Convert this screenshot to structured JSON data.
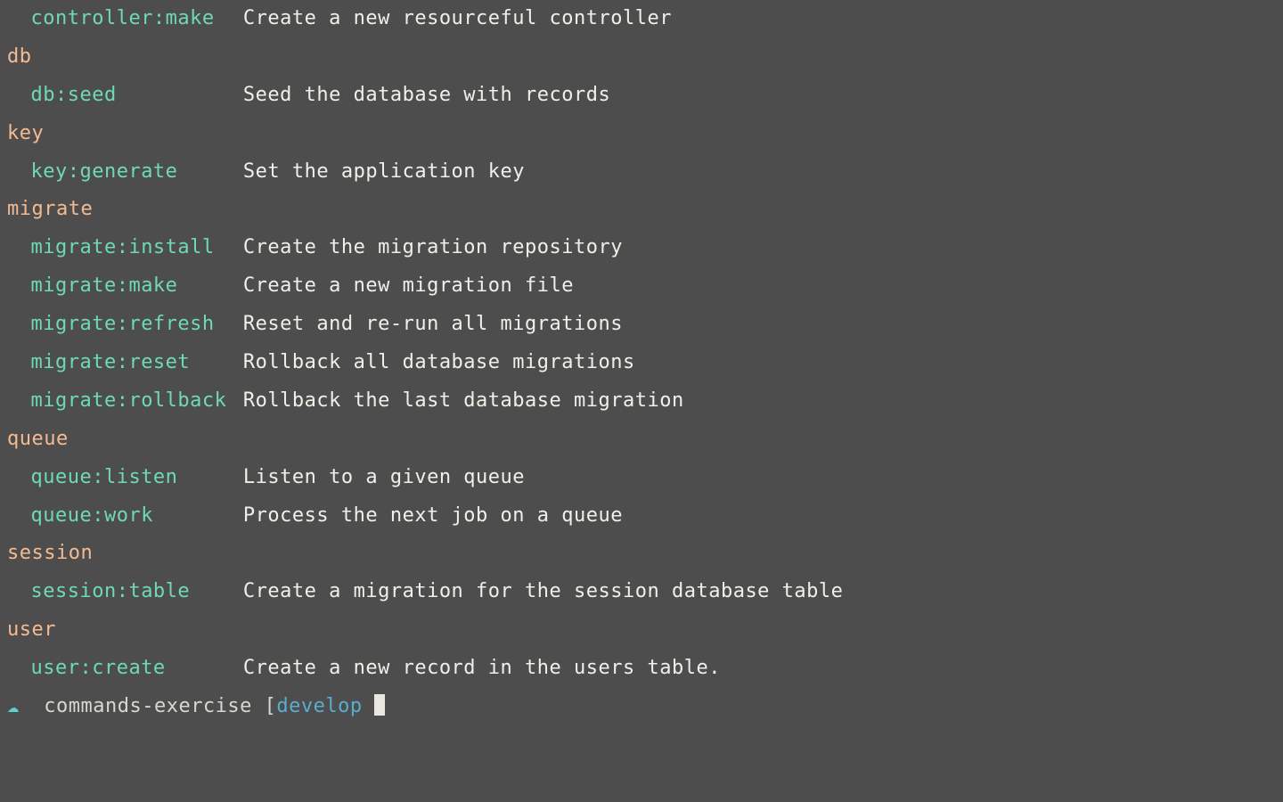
{
  "lines": [
    {
      "type": "command",
      "name": "controller:make",
      "desc": "Create a new resourceful controller"
    },
    {
      "type": "group",
      "label": "db"
    },
    {
      "type": "command",
      "name": "db:seed",
      "desc": "Seed the database with records"
    },
    {
      "type": "group",
      "label": "key"
    },
    {
      "type": "command",
      "name": "key:generate",
      "desc": "Set the application key"
    },
    {
      "type": "group",
      "label": "migrate"
    },
    {
      "type": "command",
      "name": "migrate:install",
      "desc": "Create the migration repository"
    },
    {
      "type": "command",
      "name": "migrate:make",
      "desc": "Create a new migration file"
    },
    {
      "type": "command",
      "name": "migrate:refresh",
      "desc": "Reset and re-run all migrations"
    },
    {
      "type": "command",
      "name": "migrate:reset",
      "desc": "Rollback all database migrations"
    },
    {
      "type": "command",
      "name": "migrate:rollback",
      "desc": "Rollback the last database migration"
    },
    {
      "type": "group",
      "label": "queue"
    },
    {
      "type": "command",
      "name": "queue:listen",
      "desc": "Listen to a given queue"
    },
    {
      "type": "command",
      "name": "queue:work",
      "desc": "Process the next job on a queue"
    },
    {
      "type": "group",
      "label": "session"
    },
    {
      "type": "command",
      "name": "session:table",
      "desc": "Create a migration for the session database table"
    },
    {
      "type": "group",
      "label": "user"
    },
    {
      "type": "command",
      "name": "user:create",
      "desc": "Create a new record in the users table."
    }
  ],
  "prompt": {
    "icon": "☁",
    "dir": "commands-exercise",
    "bracket_open": "[",
    "branch": "develop"
  }
}
